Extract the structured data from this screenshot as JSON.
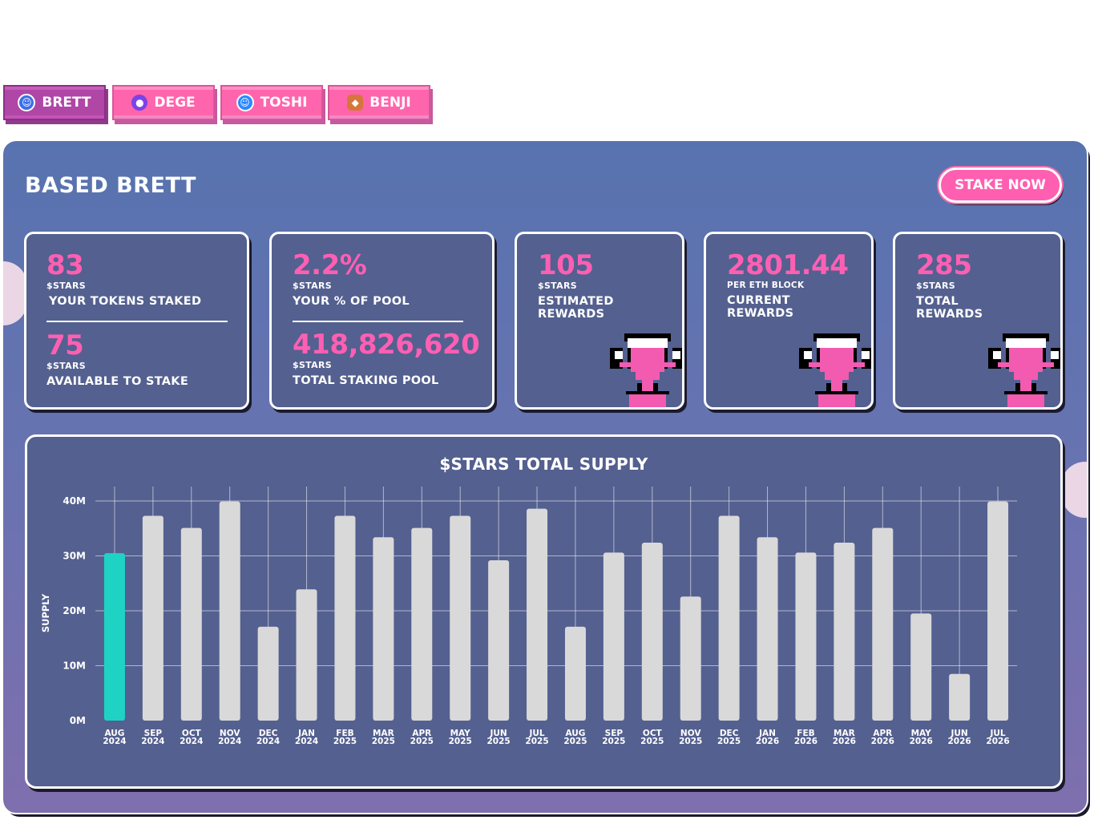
{
  "tabs": [
    {
      "label": "BRETT",
      "icon": "brett-token-icon",
      "active": true
    },
    {
      "label": "DEGE",
      "icon": "dege-token-icon",
      "active": false
    },
    {
      "label": "TOSHI",
      "icon": "toshi-token-icon",
      "active": false
    },
    {
      "label": "BENJI",
      "icon": "benji-token-icon",
      "active": false
    }
  ],
  "panel": {
    "title": "BASED BRETT",
    "stake_button": "STAKE NOW"
  },
  "cards": {
    "staked": {
      "value": "83",
      "unit": "$STARS",
      "label": "YOUR TOKENS STAKED"
    },
    "available": {
      "value": "75",
      "unit": "$STARS",
      "label": "AVAILABLE TO STAKE"
    },
    "pool_pct": {
      "value": "2.2%",
      "unit": "$STARS",
      "label": "YOUR % OF POOL"
    },
    "pool_total": {
      "value": "418,826,620",
      "unit": "$STARS",
      "label": "TOTAL STAKING POOL"
    },
    "estimated": {
      "value": "105",
      "unit": "$STARS",
      "label_1": "ESTIMATED",
      "label_2": "REWARDS"
    },
    "current": {
      "value": "2801.44",
      "unit": "PER ETH BLOCK",
      "label_1": "CURRENT",
      "label_2": "REWARDS"
    },
    "total": {
      "value": "285",
      "unit": "$STARS",
      "label_1": "TOTAL",
      "label_2": "REWARDS"
    }
  },
  "colors": {
    "accent_pink": "#ff5fb3",
    "highlight_bar": "#1fd3c4",
    "bar": "#d9d9d9",
    "card_bg": "#54608f"
  },
  "chart_data": {
    "type": "bar",
    "title": "$STARS TOTAL SUPPLY",
    "xlabel": "",
    "ylabel": "SUPPLY",
    "ylim": [
      0,
      40000000
    ],
    "yticks": [
      "0M",
      "10M",
      "20M",
      "30M",
      "40M"
    ],
    "grid": true,
    "categories": [
      [
        "AUG",
        "2024"
      ],
      [
        "SEP",
        "2024"
      ],
      [
        "OCT",
        "2024"
      ],
      [
        "NOV",
        "2024"
      ],
      [
        "DEC",
        "2024"
      ],
      [
        "JAN",
        "2024"
      ],
      [
        "FEB",
        "2025"
      ],
      [
        "MAR",
        "2025"
      ],
      [
        "APR",
        "2025"
      ],
      [
        "MAY",
        "2025"
      ],
      [
        "JUN",
        "2025"
      ],
      [
        "JUL",
        "2025"
      ],
      [
        "AUG",
        "2025"
      ],
      [
        "SEP",
        "2025"
      ],
      [
        "OCT",
        "2025"
      ],
      [
        "NOV",
        "2025"
      ],
      [
        "DEC",
        "2025"
      ],
      [
        "JAN",
        "2026"
      ],
      [
        "FEB",
        "2026"
      ],
      [
        "MAR",
        "2026"
      ],
      [
        "APR",
        "2026"
      ],
      [
        "MAY",
        "2026"
      ],
      [
        "JUN",
        "2026"
      ],
      [
        "JUL",
        "2026"
      ]
    ],
    "values": [
      30500000,
      37300000,
      35100000,
      39900000,
      17100000,
      23900000,
      37300000,
      33400000,
      35100000,
      37300000,
      29200000,
      38600000,
      17100000,
      30600000,
      32400000,
      22600000,
      37300000,
      33400000,
      30600000,
      32400000,
      35100000,
      19500000,
      8500000,
      39900000
    ],
    "highlight_index": 0
  }
}
